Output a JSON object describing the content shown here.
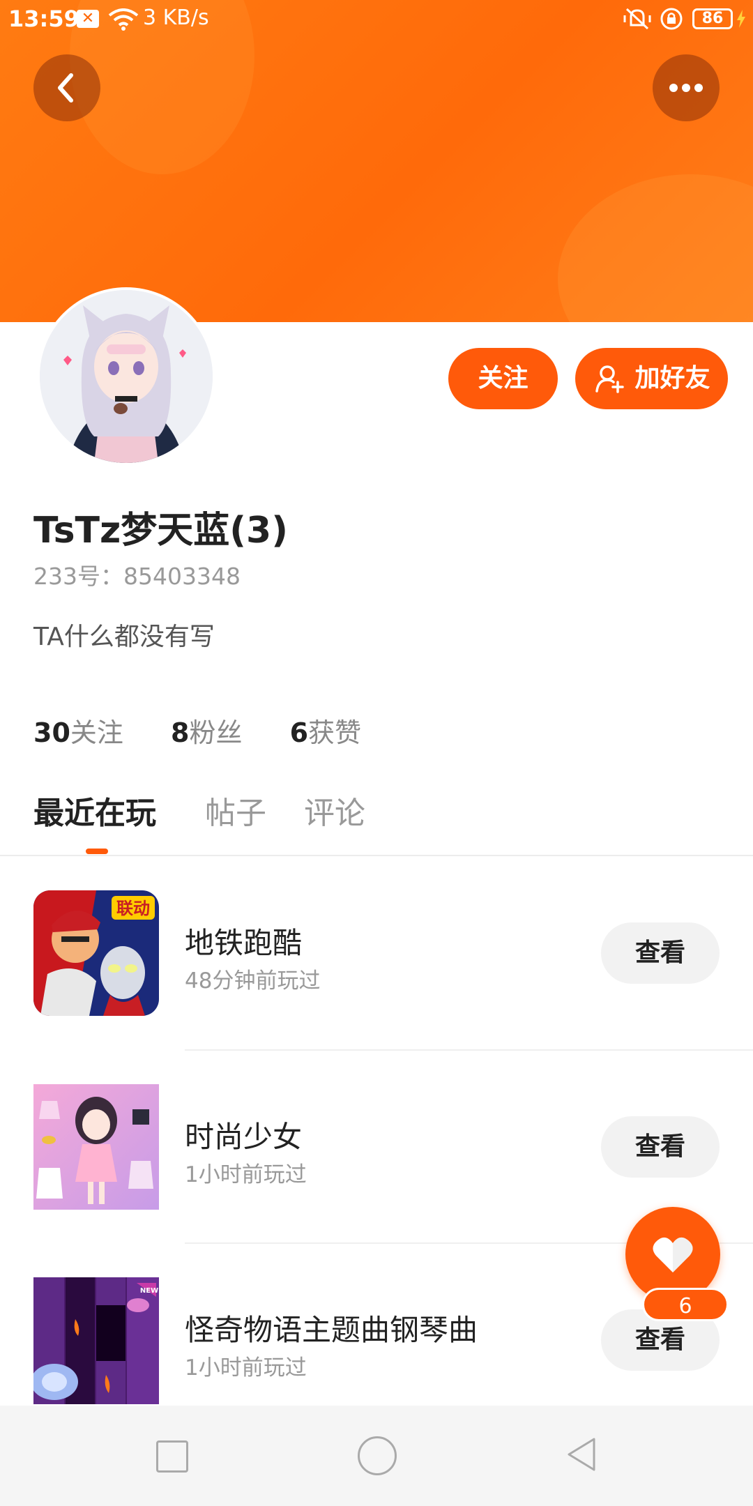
{
  "status_bar": {
    "time": "13:59",
    "notification_icon": "x-icon",
    "net_speed": "3 KB/s",
    "battery": "86"
  },
  "header": {
    "back_icon": "chevron-left-icon",
    "more_icon": "more-dots-icon",
    "accent_color": "#ff6a0a"
  },
  "actions": {
    "follow_label": "关注",
    "add_friend_label": "加好友"
  },
  "profile": {
    "name": "TsTz梦天蓝(3)",
    "id_line": "233号：85403348",
    "bio": "TA什么都没有写"
  },
  "stats": [
    {
      "value": "30",
      "label": "关注"
    },
    {
      "value": "8",
      "label": "粉丝"
    },
    {
      "value": "6",
      "label": "获赞"
    }
  ],
  "tabs": [
    {
      "label": "最近在玩",
      "active": true
    },
    {
      "label": "帖子",
      "active": false
    },
    {
      "label": "评论",
      "active": false
    }
  ],
  "games": [
    {
      "title": "地铁跑酷",
      "time": "48分钟前玩过",
      "button": "查看"
    },
    {
      "title": "时尚少女",
      "time": "1小时前玩过",
      "button": "查看"
    },
    {
      "title": "怪奇物语主题曲钢琴曲",
      "time": "1小时前玩过",
      "button": "查看"
    }
  ],
  "game_icon_text": {
    "subway_badge": "联动",
    "piano_badge": "NEW"
  },
  "fab": {
    "icon": "heart-icon",
    "count": "6"
  }
}
